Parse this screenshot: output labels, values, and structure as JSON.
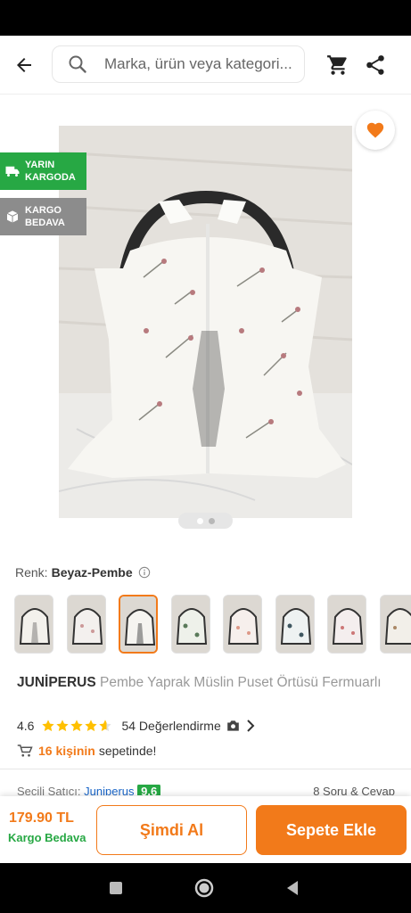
{
  "header": {
    "search_placeholder": "Marka, ürün veya kategori...",
    "icons": [
      "back-arrow-icon",
      "search-icon",
      "cart-icon",
      "share-icon"
    ]
  },
  "badges": {
    "shipping_tomorrow_line1": "YARIN",
    "shipping_tomorrow_line2": "KARGODA",
    "free_shipping_line1": "KARGO",
    "free_shipping_line2": "BEDAVA"
  },
  "gallery": {
    "current_page": 1,
    "total_pages": 2
  },
  "color": {
    "label": "Renk:",
    "value": "Beyaz-Pembe",
    "thumbnail_count": 8,
    "selected_index": 2
  },
  "product": {
    "brand": "JUNİPERUS",
    "name": "Pembe Yaprak Müslin Puset Örtüsü Fermuarlı",
    "rating": "4.6",
    "rating_value": 4.6,
    "reviews": "54 Değerlendirme",
    "cart_count": "16 kişinin",
    "cart_text": "sepetinde!"
  },
  "seller": {
    "label": "Seçili Satıcı:",
    "name": "Juniperus",
    "score": "9.6",
    "qa": "8 Soru & Cevap"
  },
  "bottom": {
    "price": "179.90 TL",
    "shipping": "Kargo Bedava",
    "buy_now": "Şimdi Al",
    "add_to_cart": "Sepete Ekle"
  },
  "colors": {
    "accent": "#f27a1a",
    "green": "#27a844",
    "grey_badge": "#8c8c8c"
  }
}
